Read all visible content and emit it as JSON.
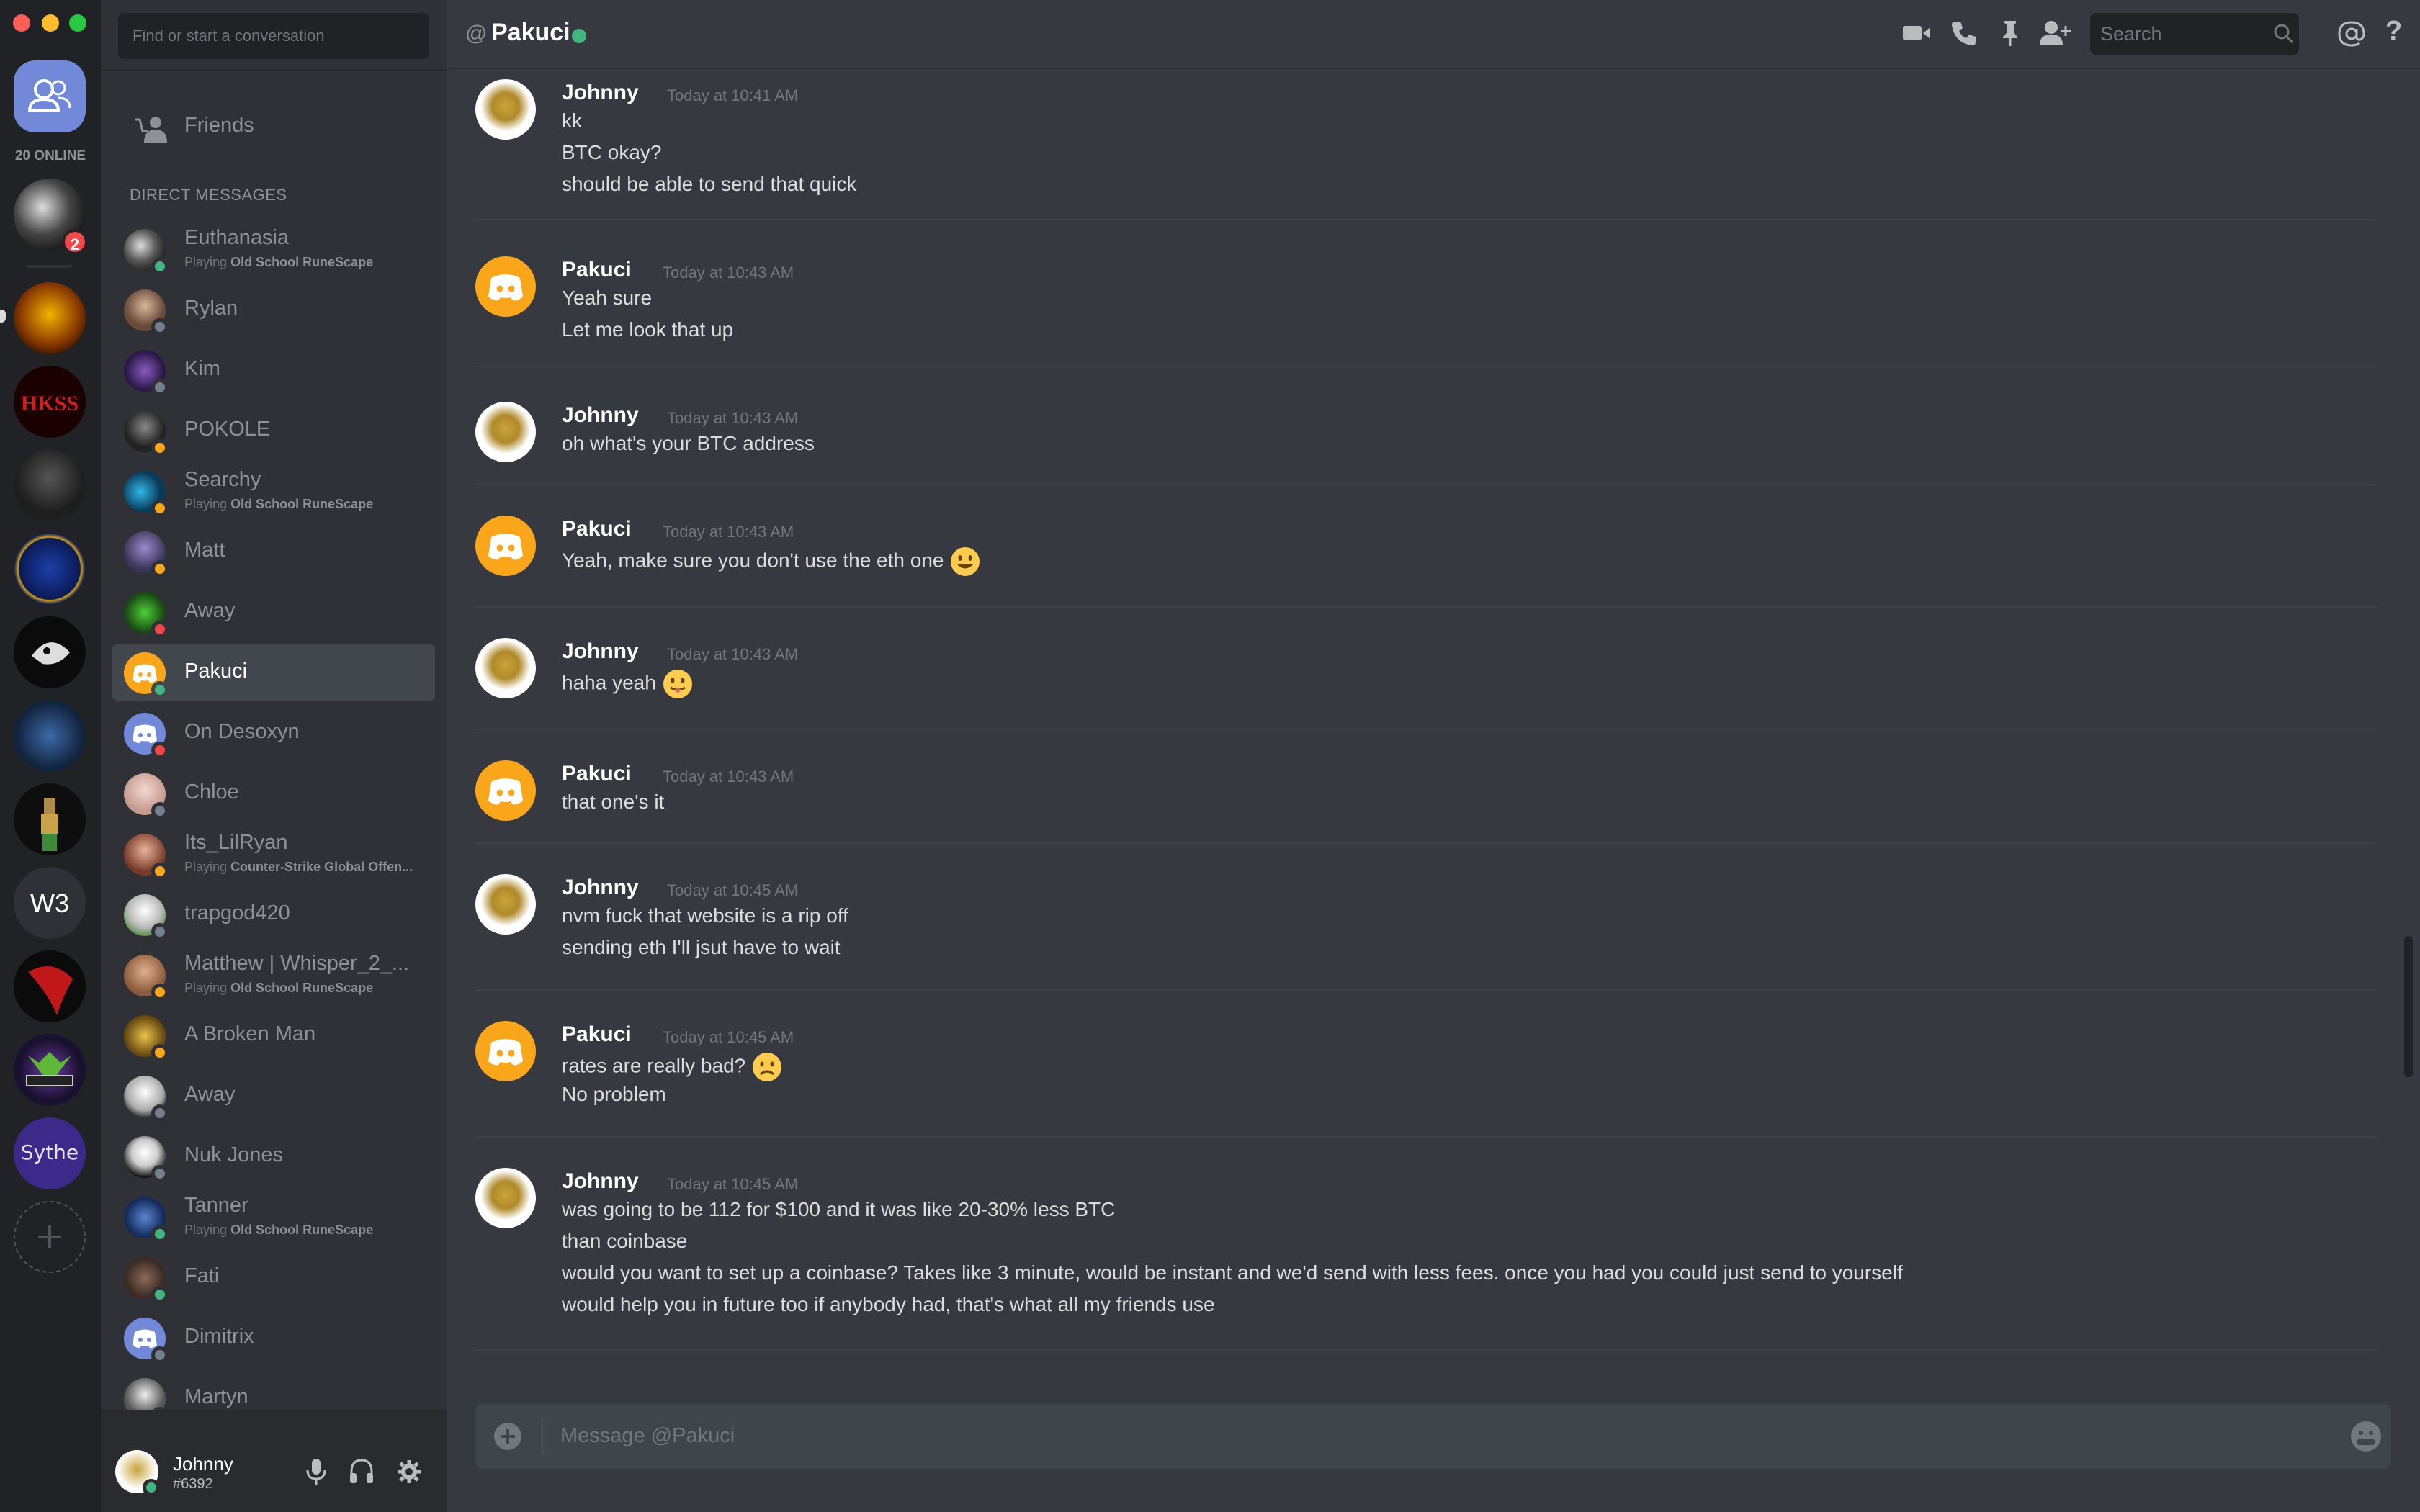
{
  "window": {
    "colors": {
      "close": "#ff5f57",
      "minimize": "#ffbd2e",
      "zoom": "#28c840"
    }
  },
  "servers": {
    "online_label": "20 ONLINE",
    "unread_badge": "2",
    "w3_label": "W3",
    "sythe_label": "Sythe"
  },
  "sidebar": {
    "find_placeholder": "Find or start a conversation",
    "friends_label": "Friends",
    "dm_header": "DIRECT MESSAGES",
    "dms": [
      {
        "name": "Euthanasia",
        "activity_prefix": "Playing",
        "activity": "Old School RuneScape",
        "status": "online"
      },
      {
        "name": "Rylan",
        "status": "offline"
      },
      {
        "name": "Kim",
        "status": "offline"
      },
      {
        "name": "POKOLE",
        "status": "idle"
      },
      {
        "name": "Searchy",
        "activity_prefix": "Playing",
        "activity": "Old School RuneScape",
        "status": "idle"
      },
      {
        "name": "Matt",
        "status": "idle"
      },
      {
        "name": "Away",
        "status": "dnd"
      },
      {
        "name": "Pakuci",
        "status": "online",
        "active": true
      },
      {
        "name": "On Desoxyn",
        "status": "dnd"
      },
      {
        "name": "Chloe",
        "status": "offline"
      },
      {
        "name": "Its_LilRyan",
        "activity_prefix": "Playing",
        "activity": "Counter-Strike Global Offen...",
        "status": "idle"
      },
      {
        "name": "trapgod420",
        "status": "offline"
      },
      {
        "name": "Matthew | Whisper_2_...",
        "activity_prefix": "Playing",
        "activity": "Old School RuneScape",
        "status": "idle"
      },
      {
        "name": "A Broken Man",
        "status": "idle"
      },
      {
        "name": "Away",
        "status": "offline"
      },
      {
        "name": "Nuk Jones",
        "status": "offline"
      },
      {
        "name": "Tanner",
        "activity_prefix": "Playing",
        "activity": "Old School RuneScape",
        "status": "online"
      },
      {
        "name": "Fati",
        "status": "online"
      },
      {
        "name": "Dimitrix",
        "status": "offline"
      },
      {
        "name": "Martyn",
        "status": "offline"
      }
    ],
    "status_colors": {
      "online": "#43b581",
      "idle": "#faa61a",
      "dnd": "#f04747",
      "offline": "#747f8d"
    }
  },
  "user": {
    "name": "Johnny",
    "tag": "#6392"
  },
  "header": {
    "at": "@",
    "title": "Pakuci",
    "search_placeholder": "Search",
    "help": "?"
  },
  "messages": [
    {
      "author": "Johnny",
      "time": "Today at 10:41 AM",
      "lines": [
        "kk",
        "BTC okay?",
        "should be able to send that quick"
      ]
    },
    {
      "author": "Pakuci",
      "time": "Today at 10:43 AM",
      "lines": [
        "Yeah sure",
        "Let me look that up"
      ]
    },
    {
      "author": "Johnny",
      "time": "Today at 10:43 AM",
      "lines": [
        "oh what's your BTC address"
      ]
    },
    {
      "author": "Pakuci",
      "time": "Today at 10:43 AM",
      "lines": [
        "Yeah, make sure you don't use the eth one"
      ],
      "emoji": "smiley"
    },
    {
      "author": "Johnny",
      "time": "Today at 10:43 AM",
      "lines": [
        "haha yeah"
      ],
      "emoji": "tongue"
    },
    {
      "author": "Pakuci",
      "time": "Today at 10:43 AM",
      "lines": [
        "that one's it"
      ]
    },
    {
      "author": "Johnny",
      "time": "Today at 10:45 AM",
      "lines": [
        "nvm fuck that website is a rip off",
        "sending eth I'll jsut have to wait"
      ]
    },
    {
      "author": "Pakuci",
      "time": "Today at 10:45 AM",
      "lines": [
        "rates are really bad?",
        "No problem"
      ],
      "emoji": "frown"
    },
    {
      "author": "Johnny",
      "time": "Today at 10:45 AM",
      "lines": [
        "was going to be 112 for $100 and it was like 20-30% less BTC",
        "than coinbase",
        "would you want to set up a coinbase? Takes like 3 minute, would be instant and we'd send with less fees. once you had you could just send to yourself",
        "would help you in future too if anybody had, that's what all my friends use"
      ]
    }
  ],
  "composer": {
    "placeholder": "Message @Pakuci"
  },
  "colors": {
    "brand": "#7289da",
    "discord_orange": "#faa61a"
  }
}
